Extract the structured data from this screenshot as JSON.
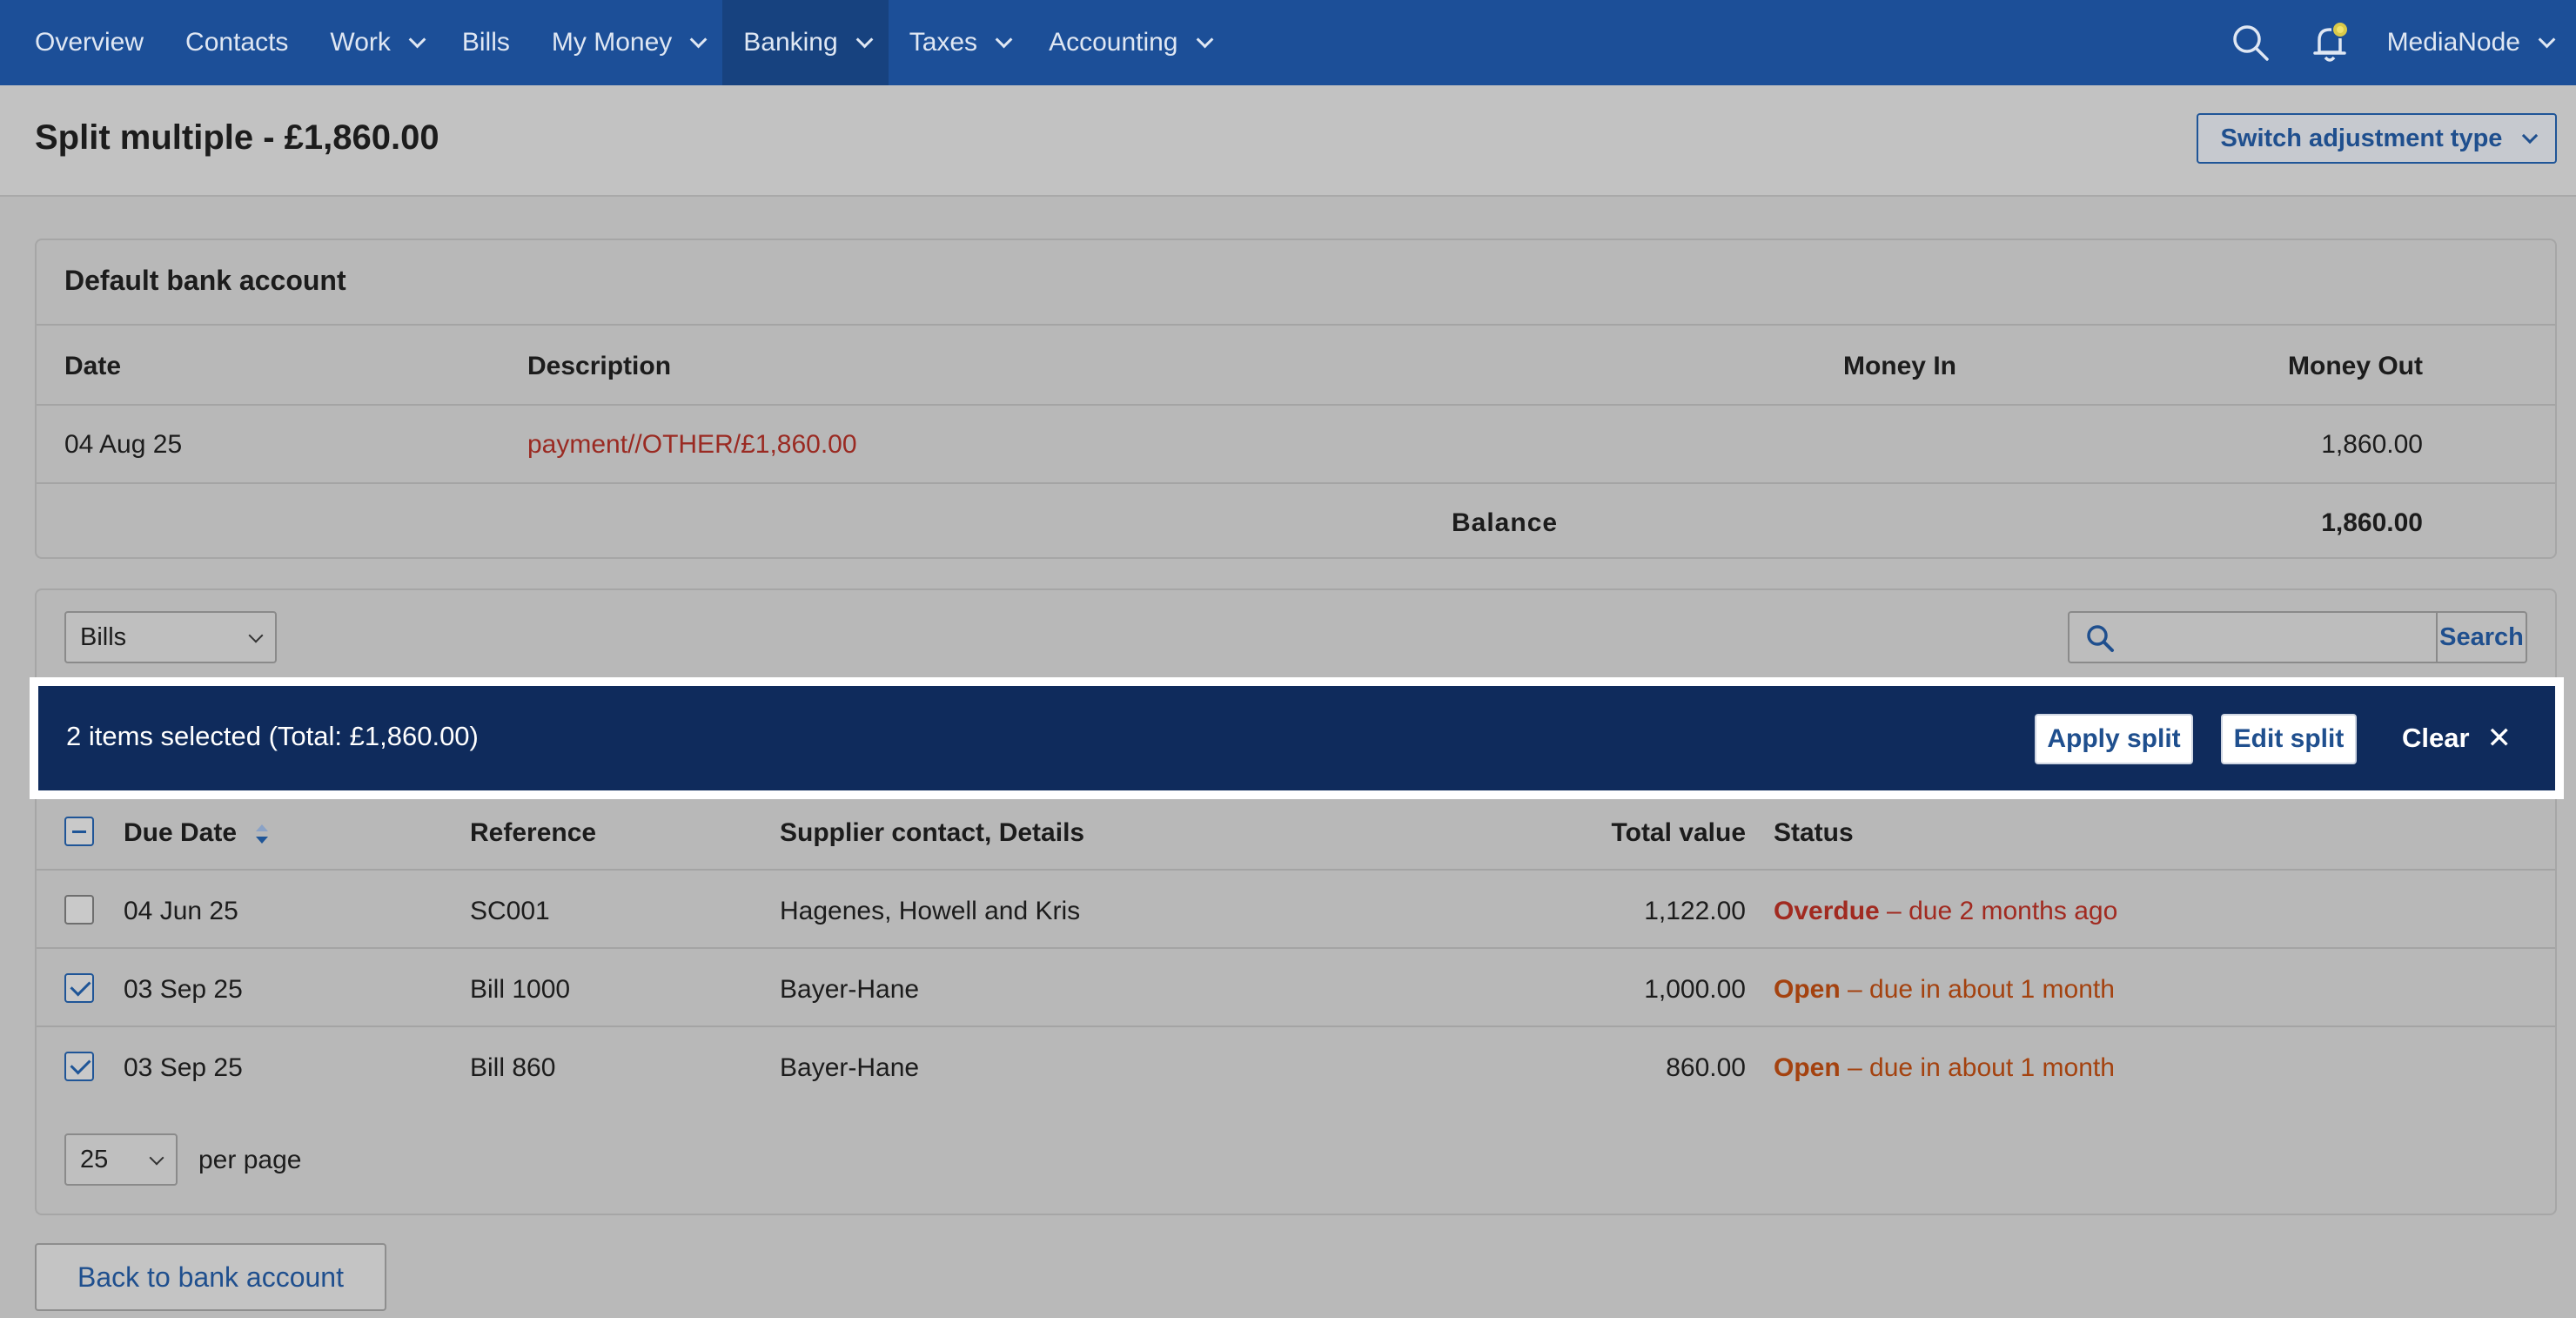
{
  "nav": {
    "items": [
      {
        "label": "Overview",
        "dropdown": false,
        "active": false
      },
      {
        "label": "Contacts",
        "dropdown": false,
        "active": false
      },
      {
        "label": "Work",
        "dropdown": true,
        "active": false
      },
      {
        "label": "Bills",
        "dropdown": false,
        "active": false
      },
      {
        "label": "My Money",
        "dropdown": true,
        "active": false
      },
      {
        "label": "Banking",
        "dropdown": true,
        "active": true
      },
      {
        "label": "Taxes",
        "dropdown": true,
        "active": false
      },
      {
        "label": "Accounting",
        "dropdown": true,
        "active": false
      }
    ],
    "user": "MediaNode",
    "icons": [
      "search-icon",
      "notification-bell-icon"
    ],
    "bar_color": "#1c4f98"
  },
  "header": {
    "title": "Split multiple - £1,860.00",
    "switch_label": "Switch adjustment type"
  },
  "bank": {
    "title": "Default bank account",
    "columns": {
      "date": "Date",
      "description": "Description",
      "money_in": "Money In",
      "money_out": "Money Out"
    },
    "row": {
      "date": "04 Aug 25",
      "description": "payment//OTHER/£1,860.00",
      "money_in": "",
      "money_out": "1,860.00"
    },
    "balance_label": "Balance",
    "balance_value": "1,860.00"
  },
  "bills": {
    "filter_value": "Bills",
    "search_placeholder": "",
    "search_label": "Search",
    "selection": {
      "text": "2 items selected (Total: £1,860.00)",
      "apply_label": "Apply split",
      "edit_label": "Edit split",
      "clear_label": "Clear",
      "bar_color": "#0f2b5c"
    },
    "columns": {
      "due_date": "Due Date",
      "reference": "Reference",
      "supplier": "Supplier contact, Details",
      "total": "Total value",
      "status": "Status"
    },
    "rows": [
      {
        "due_date": "04 Jun 25",
        "reference": "SC001",
        "supplier": "Hagenes, Howell and Kris",
        "total": "1,122.00",
        "status_label": "Overdue",
        "status_detail": " – due 2 months ago",
        "checked": false
      },
      {
        "due_date": "03 Sep 25",
        "reference": "Bill 1000",
        "supplier": "Bayer-Hane",
        "total": "1,000.00",
        "status_label": "Open",
        "status_detail": " – due in about 1 month",
        "checked": true
      },
      {
        "due_date": "03 Sep 25",
        "reference": "Bill 860",
        "supplier": "Bayer-Hane",
        "total": "860.00",
        "status_label": "Open",
        "status_detail": " – due in about 1 month",
        "checked": true
      }
    ],
    "per_page_value": "25",
    "per_page_label": "per page"
  },
  "footer": {
    "back_label": "Back to bank account"
  }
}
